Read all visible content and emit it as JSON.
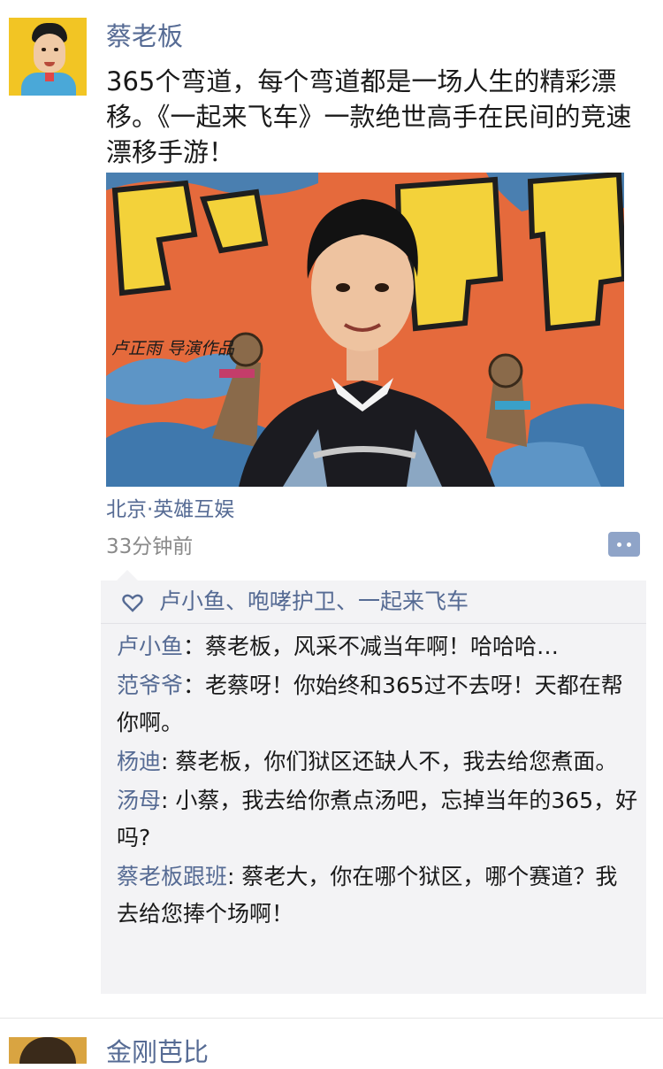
{
  "post": {
    "author": "蔡老板",
    "text": "365个弯道，每个弯道都是一场人生的精彩漂移。《一起来飞车》一款绝世高手在民间的竞速漂移手游！",
    "image": {
      "banner_text": "绝世高手",
      "credit_text": "卢正雨 导演作品"
    },
    "location": "北京·英雄互娱",
    "time": "33分钟前"
  },
  "likes": {
    "names": "卢小鱼、咆哮护卫、一起来飞车"
  },
  "comments": [
    {
      "user": "卢小鱼",
      "sep": "：",
      "text": "蔡老板，风采不减当年啊！哈哈哈…"
    },
    {
      "user": "范爷爷",
      "sep": "：",
      "text": "老蔡呀！你始终和365过不去呀！天都在帮你啊。"
    },
    {
      "user": "杨迪",
      "sep": ": ",
      "text": "蔡老板，你们狱区还缺人不，我去给您煮面。"
    },
    {
      "user": "汤母",
      "sep": ": ",
      "text": "小蔡，我去给你煮点汤吧，忘掉当年的365，好吗?"
    },
    {
      "user": "蔡老板跟班",
      "sep": ": ",
      "text": "蔡老大，你在哪个狱区，哪个赛道？我去给您捧个场啊！"
    }
  ],
  "next_post": {
    "author": "金刚芭比"
  },
  "colors": {
    "link": "#566b94",
    "comment_bg": "#f3f3f5",
    "time": "#8a8a8a"
  }
}
